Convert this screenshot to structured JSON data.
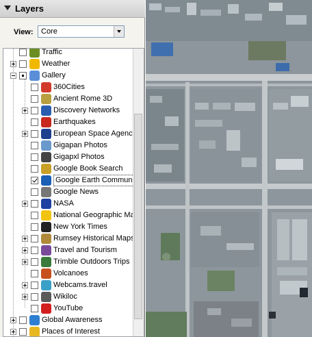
{
  "panel": {
    "title": "Layers"
  },
  "view": {
    "label": "View:",
    "value": "Core"
  },
  "tree": {
    "items": [
      {
        "label": "Traffic",
        "level": 1,
        "expander": "none",
        "check": "none",
        "icon": "traffic-icon",
        "color": "#6b8e23"
      },
      {
        "label": "Weather",
        "level": 1,
        "expander": "plus",
        "check": "none",
        "icon": "sun-icon",
        "color": "#f0b800"
      },
      {
        "label": "Gallery",
        "level": 1,
        "expander": "minus",
        "check": "partial",
        "icon": "star-icon",
        "color": "#5a8fd8"
      },
      {
        "label": "360Cities",
        "level": 2,
        "expander": "none",
        "check": "none",
        "icon": "360cities-icon",
        "color": "#d23a2c"
      },
      {
        "label": "Ancient Rome 3D",
        "level": 2,
        "expander": "none",
        "check": "none",
        "icon": "cube-icon",
        "color": "#b8a040"
      },
      {
        "label": "Discovery Networks",
        "level": 2,
        "expander": "plus",
        "check": "none",
        "icon": "globe-icon",
        "color": "#2a5db0"
      },
      {
        "label": "Earthquakes",
        "level": 2,
        "expander": "none",
        "check": "none",
        "icon": "seismograph-icon",
        "color": "#c8281e"
      },
      {
        "label": "European Space Agency",
        "level": 2,
        "expander": "plus",
        "check": "none",
        "icon": "esa-icon",
        "color": "#1f3f8f"
      },
      {
        "label": "Gigapan Photos",
        "level": 2,
        "expander": "none",
        "check": "none",
        "icon": "magnifier-icon",
        "color": "#6a9acb"
      },
      {
        "label": "Gigapxl Photos",
        "level": 2,
        "expander": "none",
        "check": "none",
        "icon": "camera-icon",
        "color": "#444444"
      },
      {
        "label": "Google Book Search",
        "level": 2,
        "expander": "none",
        "check": "none",
        "icon": "book-icon",
        "color": "#c8a028"
      },
      {
        "label": "Google Earth Community",
        "level": 2,
        "expander": "none",
        "check": "checked",
        "icon": "info-icon",
        "color": "#1a5fb4",
        "selected": true
      },
      {
        "label": "Google News",
        "level": 2,
        "expander": "none",
        "check": "none",
        "icon": "news-icon",
        "color": "#777777"
      },
      {
        "label": "NASA",
        "level": 2,
        "expander": "plus",
        "check": "none",
        "icon": "nasa-icon",
        "color": "#1e40a0"
      },
      {
        "label": "National Geographic Mag",
        "level": 2,
        "expander": "none",
        "check": "none",
        "icon": "natgeo-icon",
        "color": "#f2c40f"
      },
      {
        "label": "New York Times",
        "level": 2,
        "expander": "none",
        "check": "none",
        "icon": "nyt-icon",
        "color": "#222222"
      },
      {
        "label": "Rumsey Historical Maps",
        "level": 2,
        "expander": "plus",
        "check": "none",
        "icon": "compass-icon",
        "color": "#b08a3a"
      },
      {
        "label": "Travel and Tourism",
        "level": 2,
        "expander": "plus",
        "check": "none",
        "icon": "suitcase-icon",
        "color": "#7a4a9a"
      },
      {
        "label": "Trimble Outdoors Trips",
        "level": 2,
        "expander": "plus",
        "check": "none",
        "icon": "trimble-icon",
        "color": "#3a7a3a"
      },
      {
        "label": "Volcanoes",
        "level": 2,
        "expander": "none",
        "check": "none",
        "icon": "volcano-icon",
        "color": "#c8501e"
      },
      {
        "label": "Webcams.travel",
        "level": 2,
        "expander": "plus",
        "check": "none",
        "icon": "webcam-icon",
        "color": "#3aa0c8"
      },
      {
        "label": "Wikiloc",
        "level": 2,
        "expander": "plus",
        "check": "none",
        "icon": "wikiloc-icon",
        "color": "#5a5a5a"
      },
      {
        "label": "YouTube",
        "level": 2,
        "expander": "none",
        "check": "none",
        "icon": "youtube-icon",
        "color": "#d21e1e"
      },
      {
        "label": "Global Awareness",
        "level": 1,
        "expander": "plus",
        "check": "none",
        "icon": "globe-icon",
        "color": "#2f7fd0"
      },
      {
        "label": "Places of Interest",
        "level": 1,
        "expander": "plus",
        "check": "none",
        "icon": "flag-icon",
        "color": "#e8b820"
      }
    ]
  },
  "map": {
    "description_colors": {
      "ground": "#8b949a",
      "road": "#c9cdd0",
      "roof": "#a9b3b8",
      "green": "#5e7a5a",
      "blue": "#3f70b0"
    }
  }
}
